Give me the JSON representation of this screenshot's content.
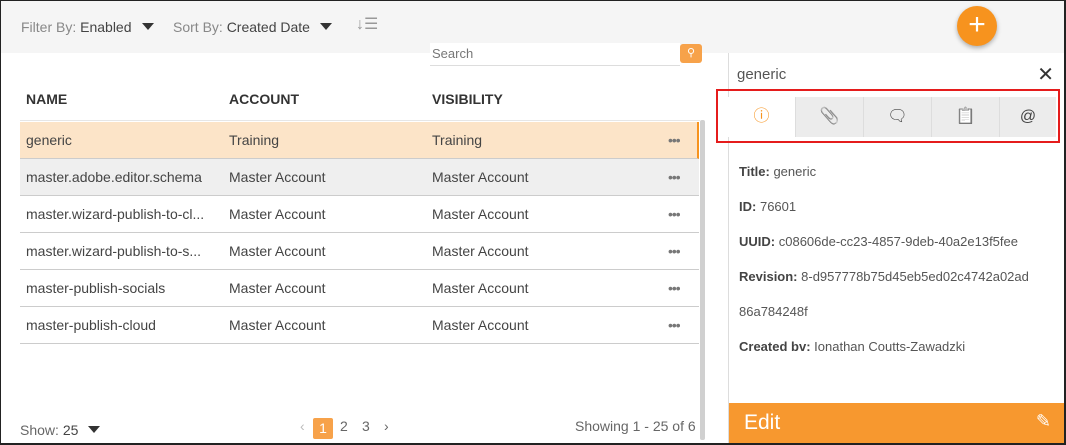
{
  "toolbar": {
    "filter_label": "Filter By:",
    "filter_value": "Enabled",
    "sort_label": "Sort By:",
    "sort_value": "Created Date",
    "sort_icon": "sort-descending-icon",
    "add_icon": "+"
  },
  "search": {
    "placeholder": "Search",
    "icon": "⚲"
  },
  "table": {
    "headers": [
      "NAME",
      "ACCOUNT",
      "VISIBILITY"
    ],
    "rows": [
      {
        "name": "generic",
        "account": "Training",
        "visibility": "Training"
      },
      {
        "name": "master.adobe.editor.schema",
        "account": "Master Account",
        "visibility": "Master Account"
      },
      {
        "name": "master.wizard-publish-to-cl...",
        "account": "Master Account",
        "visibility": "Master Account"
      },
      {
        "name": "master.wizard-publish-to-s...",
        "account": "Master Account",
        "visibility": "Master Account"
      },
      {
        "name": "master-publish-socials",
        "account": "Master Account",
        "visibility": "Master Account"
      },
      {
        "name": "master-publish-cloud",
        "account": "Master Account",
        "visibility": "Master Account"
      }
    ],
    "more": "•••"
  },
  "footer": {
    "show_label": "Show:",
    "show_value": "25",
    "prev": "‹",
    "pages": [
      "1",
      "2",
      "3"
    ],
    "next": "›",
    "showing": "Showing 1 - 25 of 6"
  },
  "panel": {
    "title": "generic",
    "close": "✕",
    "tabs": [
      "ⓘ",
      "📎",
      "🗨",
      "📋",
      "@"
    ],
    "fields": [
      {
        "label": "Title:",
        "value": "generic"
      },
      {
        "label": "ID:",
        "value": "76601"
      },
      {
        "label": "UUID:",
        "value": "c08606de-cc23-4857-9deb-40a2e13f5fee"
      },
      {
        "label": "Revision:",
        "value": "8-d957778b75d45eb5ed02c4742a02ad"
      },
      {
        "label": "",
        "value": "86a784248f"
      },
      {
        "label": "Created bv:",
        "value": "Ionathan Coutts-Zawadzki"
      }
    ],
    "edit": "Edit",
    "edit_icon": "✎"
  }
}
